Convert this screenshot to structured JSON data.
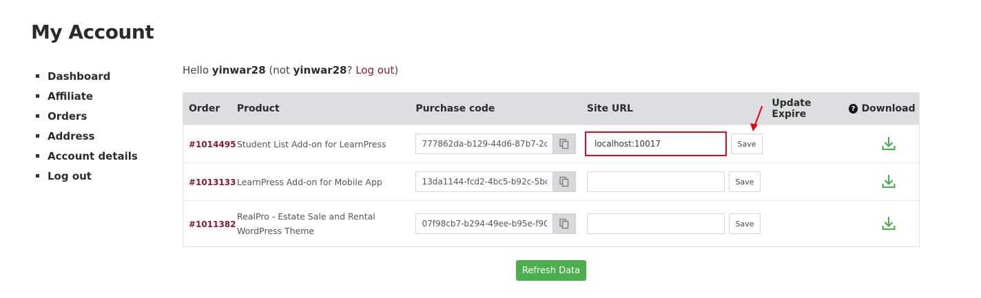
{
  "page": {
    "title": "My Account"
  },
  "nav": {
    "items": [
      {
        "label": "Dashboard"
      },
      {
        "label": "Affiliate"
      },
      {
        "label": "Orders"
      },
      {
        "label": "Address"
      },
      {
        "label": "Account details"
      },
      {
        "label": "Log out"
      }
    ]
  },
  "greeting": {
    "hello": "Hello ",
    "username": "yinwar28",
    "not_prefix": " (not ",
    "username2": "yinwar28",
    "q": "? ",
    "logout_link": "Log out",
    "close": ")"
  },
  "table": {
    "headers": {
      "order": "Order",
      "product": "Product",
      "purchase_code": "Purchase code",
      "site_url": "Site URL",
      "update_expire": "Update Expire",
      "download": "Download"
    },
    "rows": [
      {
        "order": "#1014495",
        "product": "Student List Add-on for LearnPress",
        "purchase_code": "777862da-b129-44d6-87b7-2c",
        "site_url": "localhost:10017",
        "save_label": "Save"
      },
      {
        "order": "#1013133",
        "product": "LearnPress Add-on for Mobile App",
        "purchase_code": "13da1144-fcd2-4bc5-b92c-5bc",
        "site_url": "",
        "save_label": "Save"
      },
      {
        "order": "#1011382",
        "product": "RealPro - Estate Sale and Rental WordPress Theme",
        "purchase_code": "07f98cb7-b294-49ee-b95e-f90",
        "site_url": "",
        "save_label": "Save"
      }
    ]
  },
  "refresh_button": "Refresh Data",
  "icons": {
    "copy": "copy-icon",
    "download": "download-icon",
    "help": "question-circle-icon"
  },
  "colors": {
    "accent_link": "#8a1538",
    "download_green": "#4cae4c",
    "refresh_green": "#4cae4c",
    "highlight_red": "#e10b17",
    "header_bg": "#dcdee2"
  }
}
